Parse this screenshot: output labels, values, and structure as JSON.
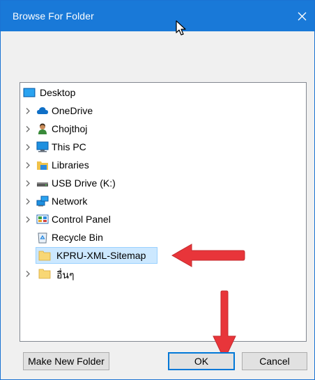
{
  "window": {
    "title": "Browse For Folder",
    "close_glyph": "✕"
  },
  "tree": {
    "root": {
      "label": "Desktop",
      "icon": "desktop-icon"
    },
    "items": [
      {
        "label": "OneDrive",
        "icon": "cloud-icon",
        "expandable": true
      },
      {
        "label": "Chojthoj",
        "icon": "user-icon",
        "expandable": true
      },
      {
        "label": "This PC",
        "icon": "computer-icon",
        "expandable": true
      },
      {
        "label": "Libraries",
        "icon": "libraries-icon",
        "expandable": true
      },
      {
        "label": "USB Drive (K:)",
        "icon": "usb-drive-icon",
        "expandable": true
      },
      {
        "label": "Network",
        "icon": "network-icon",
        "expandable": true
      },
      {
        "label": "Control Panel",
        "icon": "control-panel-icon",
        "expandable": true
      },
      {
        "label": "Recycle Bin",
        "icon": "recycle-bin-icon",
        "expandable": false
      },
      {
        "label": "KPRU-XML-Sitemap",
        "icon": "folder-icon",
        "expandable": false,
        "selected": true
      },
      {
        "label": "อื่นๆ",
        "icon": "folder-icon",
        "expandable": true
      }
    ]
  },
  "buttons": {
    "make_new_folder": "Make New Folder",
    "ok": "OK",
    "cancel": "Cancel"
  },
  "colors": {
    "titlebar": "#1979d8",
    "selection": "#cce8ff",
    "annotation_arrow": "#e8353a",
    "folder": "#f8d775"
  }
}
